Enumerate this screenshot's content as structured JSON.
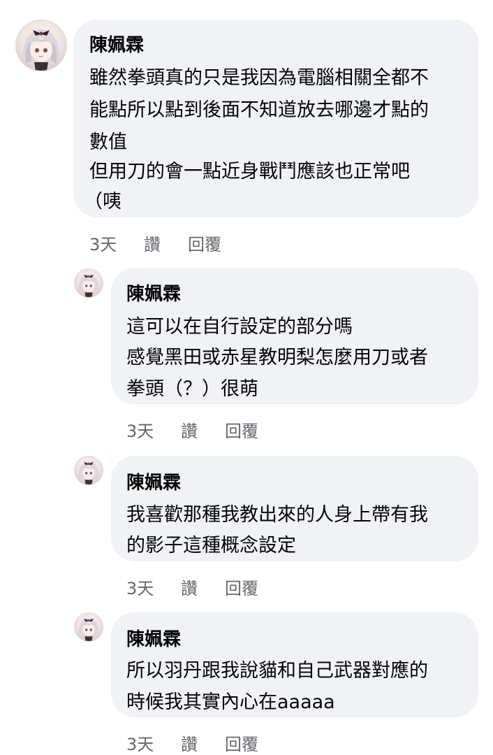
{
  "comments": [
    {
      "author": "陳姵霖",
      "lines": [
        "雖然拳頭真的只是我因為電腦相關全都不",
        "能點所以點到後面不知道放去哪邊才點的",
        "數值",
        "但用刀的會一點近身戰鬥應該也正常吧",
        "（咦"
      ],
      "time": "3天",
      "like_label": "讚",
      "reply_label": "回覆"
    },
    {
      "author": "陳姵霖",
      "lines": [
        "這可以在自行設定的部分嗎",
        "感覺黑田或赤星教明梨怎麼用刀或者",
        "拳頭（？）很萌"
      ],
      "time": "3天",
      "like_label": "讚",
      "reply_label": "回覆"
    },
    {
      "author": "陳姵霖",
      "lines": [
        "我喜歡那種我教出來的人身上帶有我",
        "的影子這種概念設定"
      ],
      "time": "3天",
      "like_label": "讚",
      "reply_label": "回覆"
    },
    {
      "author": "陳姵霖",
      "lines": [
        "所以羽丹跟我說貓和自己武器對應的",
        "時候我其實內心在aaaaa"
      ],
      "time": "3天",
      "like_label": "讚",
      "reply_label": "回覆"
    }
  ]
}
